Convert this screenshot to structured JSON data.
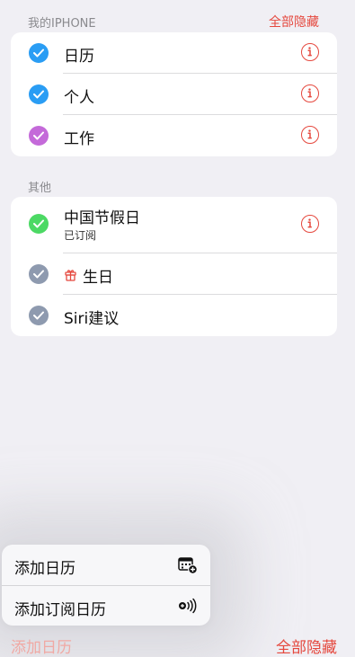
{
  "sections": [
    {
      "header": "我的IPHONE",
      "action": "全部隐藏",
      "items": [
        {
          "label": "日历",
          "color": "#2a9df4"
        },
        {
          "label": "个人",
          "color": "#2a9df4"
        },
        {
          "label": "工作",
          "color": "#c46ad9"
        }
      ]
    },
    {
      "header": "其他",
      "items": [
        {
          "label": "中国节假日",
          "sublabel": "已订阅",
          "color": "#4cd964"
        },
        {
          "label": "生日",
          "icon": "gift-icon",
          "color": "#8e9aaf"
        },
        {
          "label": "Siri建议",
          "color": "#8e9aaf"
        }
      ]
    }
  ],
  "popover": {
    "items": [
      {
        "label": "添加日历",
        "icon": "calendar-add-icon"
      },
      {
        "label": "添加订阅日历",
        "icon": "subscribe-icon"
      }
    ]
  },
  "toolbar": {
    "add_calendar": "添加日历",
    "hide_all": "全部隐藏"
  },
  "colors": {
    "accent": "#e5483e",
    "background": "#f0eff4"
  }
}
